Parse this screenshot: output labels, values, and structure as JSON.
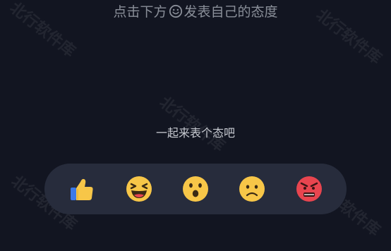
{
  "header": {
    "hint_before": "点击下方",
    "hint_after": "发表自己的态度",
    "hint_icon": "smile-outline-icon"
  },
  "prompt": {
    "text": "一起来表个态吧"
  },
  "reactions": [
    {
      "name": "thumbs-up-icon"
    },
    {
      "name": "laughing-face-icon"
    },
    {
      "name": "surprised-face-icon"
    },
    {
      "name": "sad-face-icon"
    },
    {
      "name": "angry-face-icon"
    }
  ],
  "colors": {
    "background": "#121521",
    "bar": "#272c3c",
    "emoji_yellow": "#f7c648",
    "emoji_red": "#e8454f",
    "thumb_blue": "#3b79e8"
  },
  "watermark": {
    "text": "北行软件库"
  }
}
